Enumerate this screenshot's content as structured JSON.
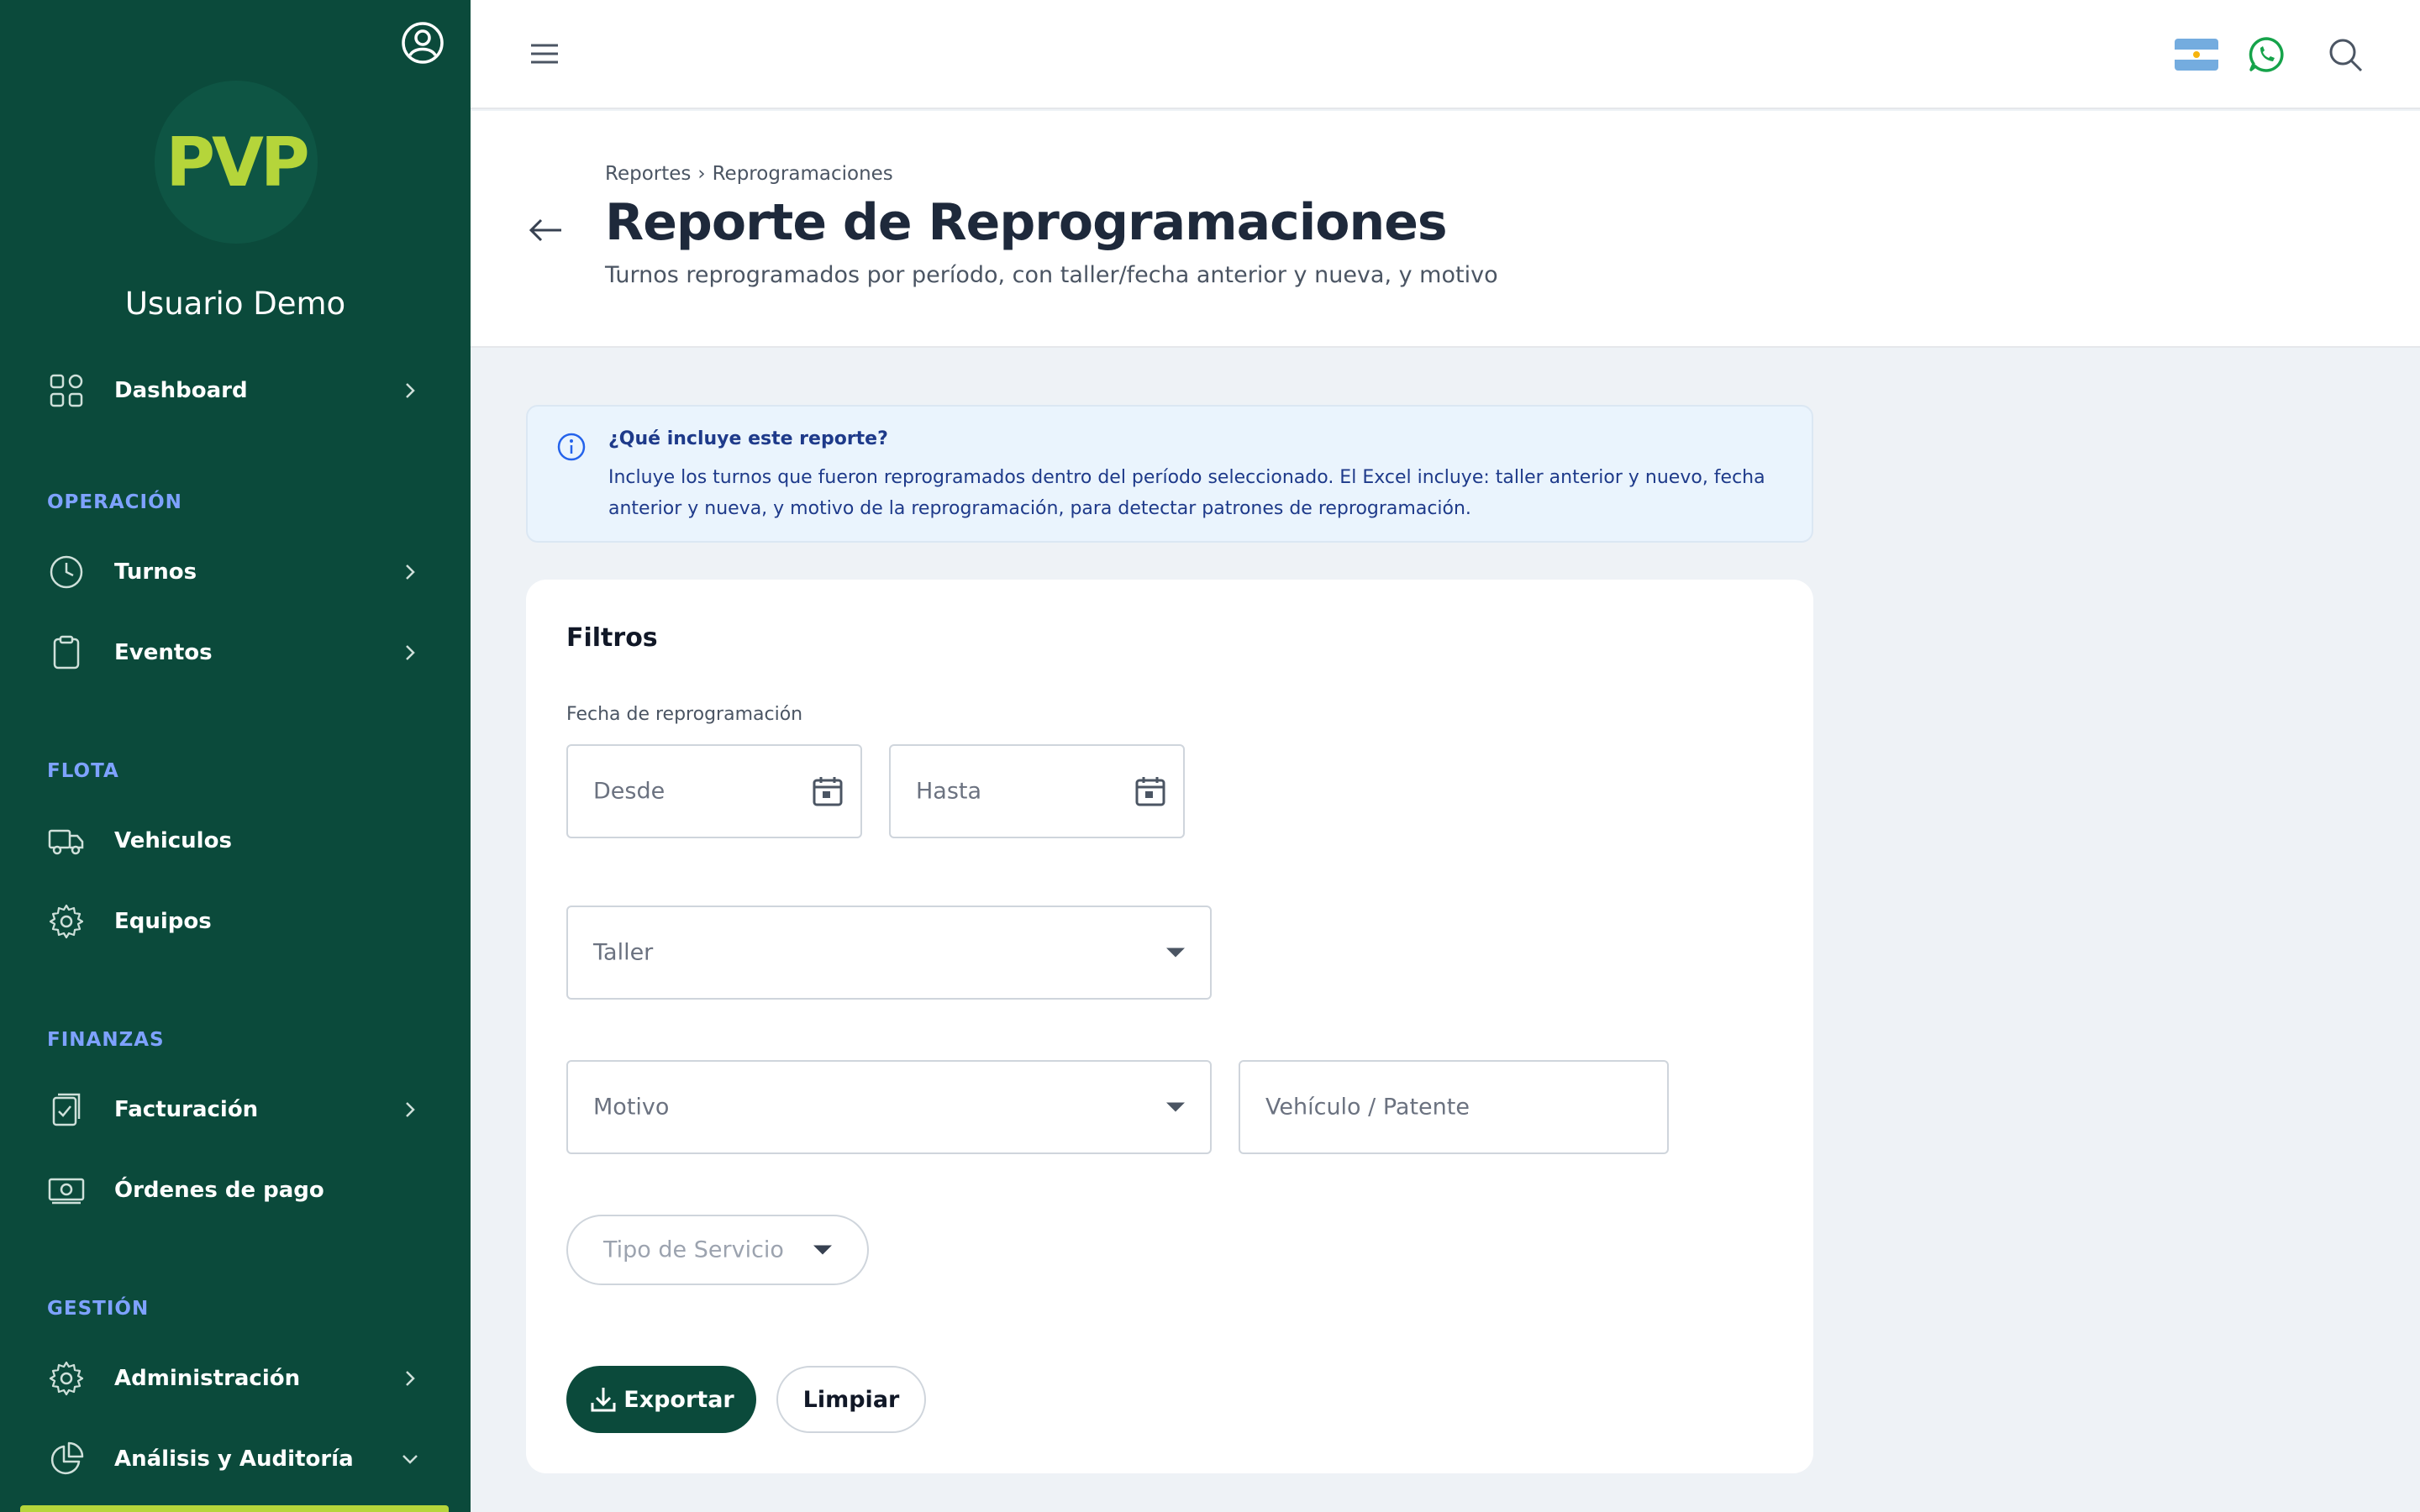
{
  "sidebar": {
    "logo_text": "PVP",
    "username": "Usuario Demo",
    "items": {
      "dashboard": "Dashboard",
      "turnos": "Turnos",
      "eventos": "Eventos",
      "vehiculos": "Vehiculos",
      "equipos": "Equipos",
      "facturacion": "Facturación",
      "ordenes": "Órdenes de pago",
      "administracion": "Administración",
      "analisis": "Análisis y Auditoría"
    },
    "sections": {
      "operacion": "OPERACIÓN",
      "flota": "FLOTA",
      "finanzas": "FINANZAS",
      "gestion": "GESTIÓN"
    }
  },
  "header": {
    "breadcrumb": [
      "Reportes",
      "Reprogramaciones"
    ],
    "breadcrumb_sep": "›",
    "title": "Reporte de Reprogramaciones",
    "subtitle": "Turnos reprogramados por período, con taller/fecha anterior y nueva, y motivo"
  },
  "info": {
    "heading": "¿Qué incluye este reporte?",
    "body": "Incluye los turnos que fueron reprogramados dentro del período seleccionado. El Excel incluye: taller anterior y nuevo, fecha anterior y nueva, y motivo de la reprogramación, para detectar patrones de reprogramación."
  },
  "filters": {
    "title": "Filtros",
    "date_label": "Fecha de reprogramación",
    "desde": "Desde",
    "hasta": "Hasta",
    "taller": "Taller",
    "motivo": "Motivo",
    "vehiculo": "Vehículo / Patente",
    "tipo_servicio": "Tipo de Servicio",
    "export_label": "Exportar",
    "clear_label": "Limpiar"
  },
  "colors": {
    "sidebar_bg": "#0b4a3b",
    "accent_lime": "#b5d53a",
    "section_label": "#7ea2ff",
    "info_bg": "#eaf4fd",
    "whatsapp": "#16a34a"
  },
  "icons": {
    "profile": "user-circle-icon",
    "menu": "hamburger-menu-icon",
    "flag": "argentina-flag-icon",
    "whatsapp": "whatsapp-icon",
    "search": "search-icon",
    "back": "arrow-left-icon",
    "info": "info-icon",
    "calendar": "calendar-icon",
    "download": "download-icon"
  }
}
